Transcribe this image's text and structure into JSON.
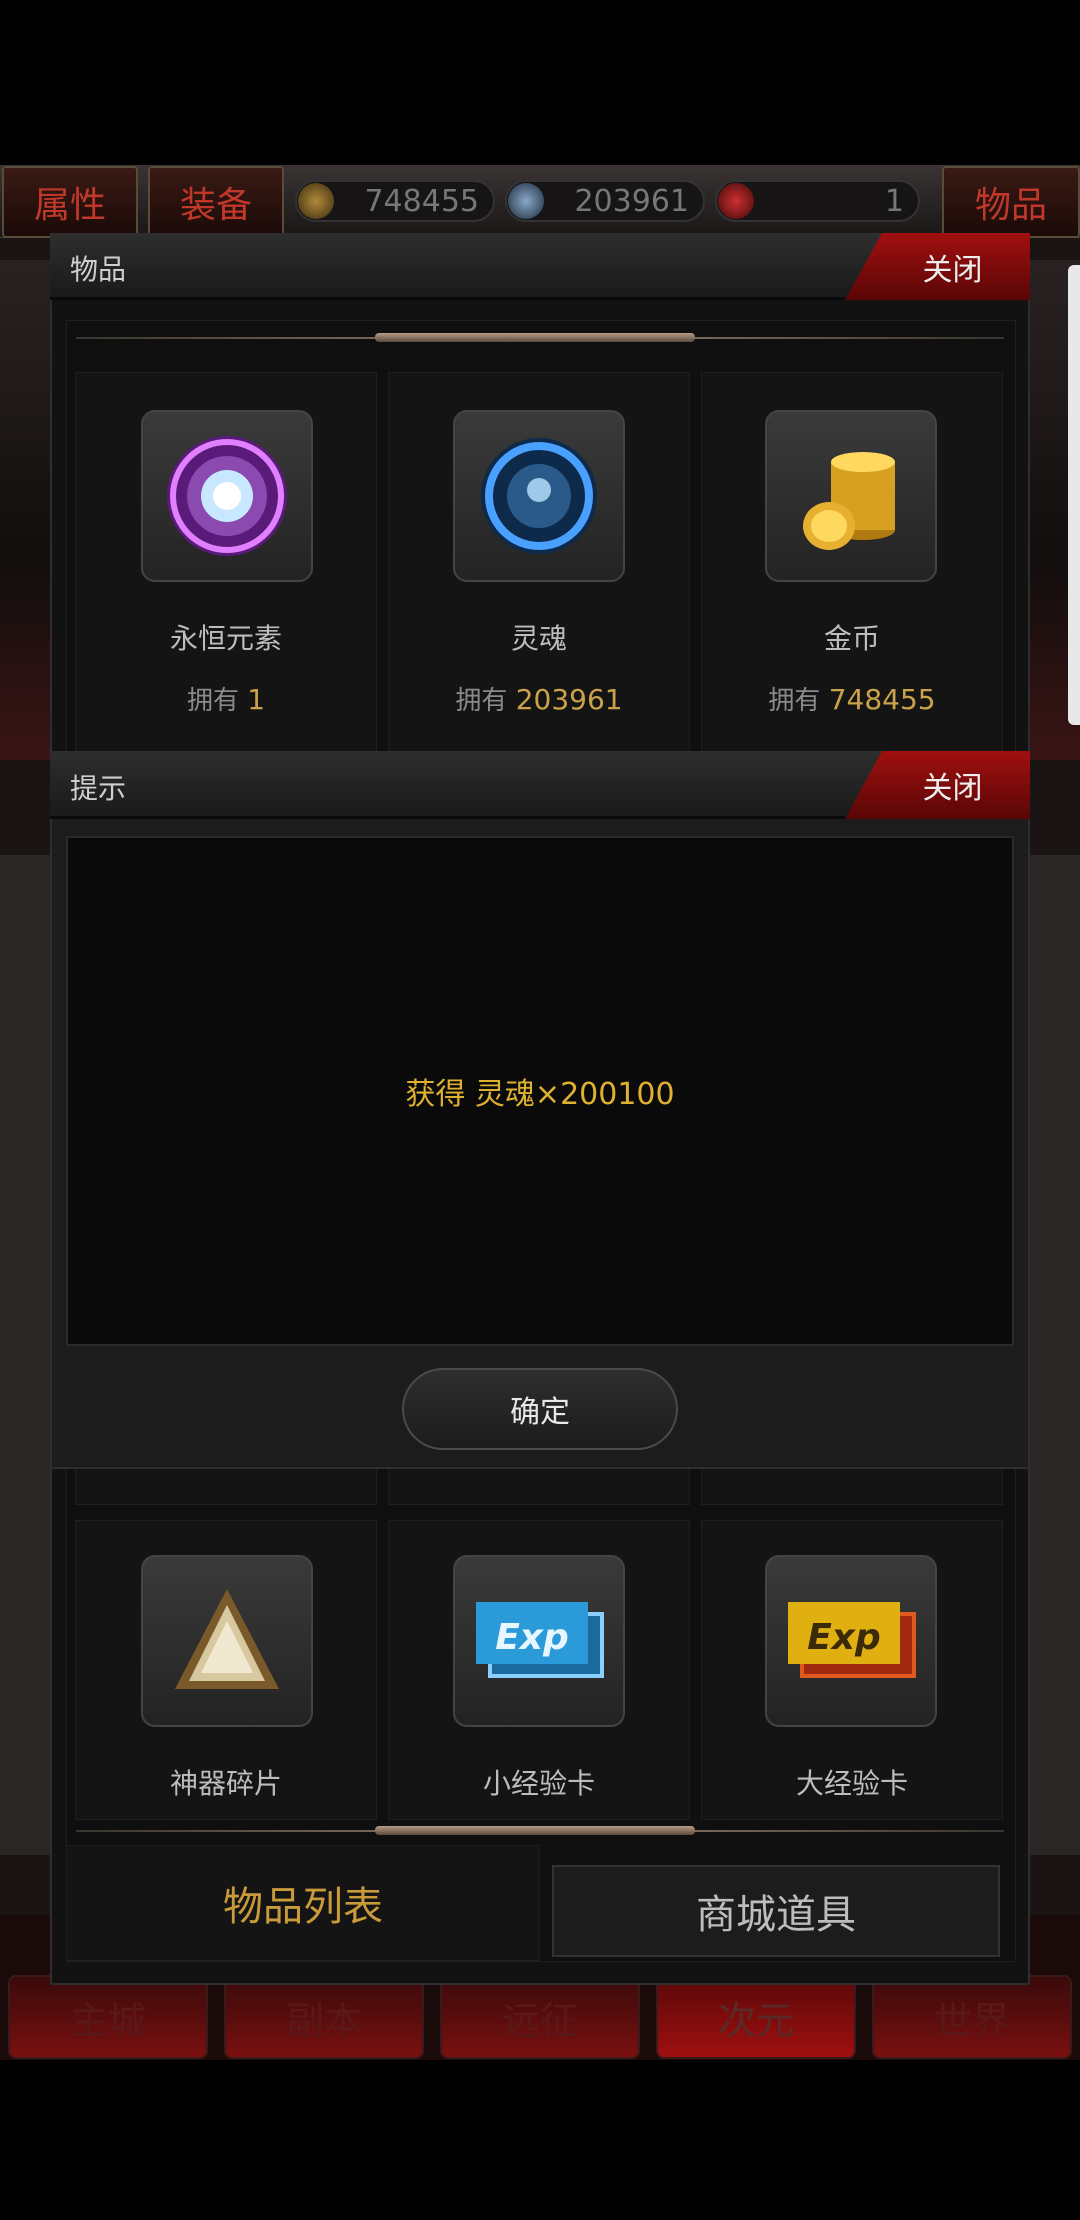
{
  "top_bar": {
    "tab_attributes": "属性",
    "tab_equipment": "装备",
    "tab_items": "物品",
    "gold_amount": "748455",
    "soul_amount": "203961",
    "third_amount": "1"
  },
  "items_panel": {
    "title": "物品",
    "close_label": "关闭",
    "own_label": "拥有",
    "items": [
      {
        "name": "永恒元素",
        "own": "1",
        "icon": "eternal-element-icon"
      },
      {
        "name": "灵魂",
        "own": "203961",
        "icon": "soul-icon"
      },
      {
        "name": "金币",
        "own": "748455",
        "icon": "gold-coin-icon"
      },
      {
        "name": "神器碎片",
        "icon": "artifact-shard-icon"
      },
      {
        "name": "小经验卡",
        "icon": "small-exp-card-icon"
      },
      {
        "name": "大经验卡",
        "icon": "large-exp-card-icon"
      }
    ],
    "exp_text": "Exp",
    "tab_item_list": "物品列表",
    "tab_shop_items": "商城道具"
  },
  "tip_dialog": {
    "title": "提示",
    "close_label": "关闭",
    "message": "获得 灵魂×200100",
    "confirm_label": "确定"
  },
  "bottom_nav": {
    "items": [
      "主城",
      "副本",
      "远征",
      "次元",
      "世界"
    ]
  },
  "colors": {
    "accent_gold": "#c9a24a",
    "close_red": "#a11010",
    "message_yellow": "#e0b030"
  }
}
